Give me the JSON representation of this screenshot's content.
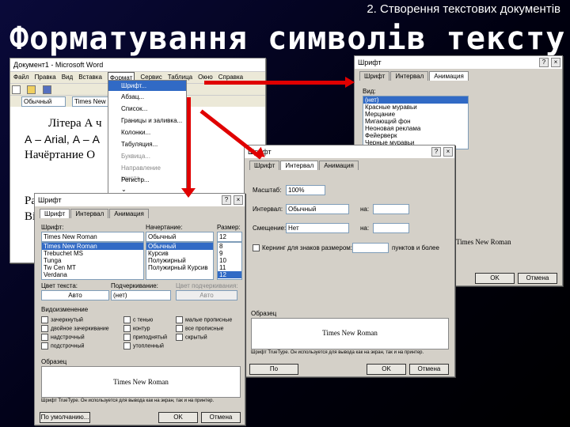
{
  "header": {
    "subtitle": "2. Створення текстових документів",
    "title": "Форматування символів тексту"
  },
  "word": {
    "title": "Документ1 - Microsoft Word",
    "menus": [
      "Файл",
      "Правка",
      "Вид",
      "Вставка",
      "Формат",
      "Сервис",
      "Таблица",
      "Окно",
      "Справка"
    ],
    "style_box": "Обычный",
    "font_box": "Times New R",
    "doc_lines": [
      "Літера А ч",
      "А – Arial, А – А",
      "Начёртание О",
      "Ра",
      "Ві"
    ],
    "format_menu": [
      "Шрифт...",
      "Абзац...",
      "Список...",
      "Границы и заливка...",
      "Колонки...",
      "Табуляция...",
      "Буквица...",
      "Направление текста...",
      "Регистр..."
    ]
  },
  "dlg_anim": {
    "title": "Шрифт",
    "tabs": [
      "Шрифт",
      "Интервал",
      "Анимация"
    ],
    "label": "Вид:",
    "items": [
      "(нет)",
      "Красные муравьи",
      "Мерцание",
      "Мигающий фон",
      "Неоновая реклама",
      "Фейерверк",
      "Черные муравьи"
    ],
    "sample": "Times New Roman",
    "ok": "OK",
    "cancel": "Отмена"
  },
  "dlg_interval": {
    "title": "Шрифт",
    "tabs": [
      "Шрифт",
      "Интервал",
      "Анимация"
    ],
    "scale_label": "Масштаб:",
    "scale_val": "100%",
    "spacing_label": "Интервал:",
    "spacing_val": "Обычный",
    "by_label": "на:",
    "offset_label": "Смещение:",
    "offset_val": "Нет",
    "by2_label": "на:",
    "kerning_label": "Кернинг для знаков размером:",
    "kerning_suffix": "пунктов и более",
    "preview_label": "Образец",
    "sample": "Times New Roman",
    "note": "Шрифт TrueType. Он используется для вывода как на экран, так и на принтер.",
    "default_btn": "По умолчанию...",
    "ok": "OK",
    "cancel": "Отмена"
  },
  "dlg_font": {
    "title": "Шрифт",
    "tabs": [
      "Шрифт",
      "Интервал",
      "Анимация"
    ],
    "font_label": "Шрифт:",
    "style_label": "Начертание:",
    "size_label": "Размер:",
    "font_val": "Times New Roman",
    "style_val": "Обычный",
    "size_val": "12",
    "fonts": [
      "Times New Roman",
      "Trebuchet MS",
      "Tunga",
      "Tw Cen MT",
      "Verdana"
    ],
    "styles": [
      "Обычный",
      "Курсив",
      "Полужирный",
      "Полужирный Курсив"
    ],
    "sizes": [
      "8",
      "9",
      "10",
      "11",
      "12"
    ],
    "color_label": "Цвет текста:",
    "color_val": "Авто",
    "underline_label": "Подчеркивание:",
    "underline_val": "(нет)",
    "ucolor_label": "Цвет подчеркивания:",
    "ucolor_val": "Авто",
    "effects_label": "Видоизменение",
    "effects": [
      [
        "зачеркнутый",
        "с тенью",
        "малые прописные"
      ],
      [
        "двойное зачеркивание",
        "контур",
        "все прописные"
      ],
      [
        "надстрочный",
        "приподнятый",
        "скрытый"
      ],
      [
        "подстрочный",
        "утопленный",
        ""
      ]
    ],
    "preview_label": "Образец",
    "sample": "Times New Roman",
    "note": "Шрифт TrueType. Он используется для вывода как на экран, так и на принтер.",
    "default_btn": "По умолчанию...",
    "ok": "OK",
    "cancel": "Отмена"
  },
  "colors": {
    "arrow": "#e00000"
  }
}
